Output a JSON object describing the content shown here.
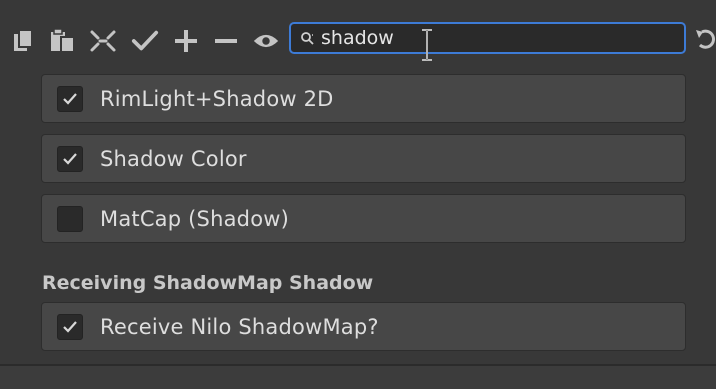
{
  "toolbar": {
    "icons": [
      "copy-icon",
      "paste-icon",
      "collapse-icon",
      "checkmark-icon",
      "plus-icon",
      "minus-icon",
      "eye-icon"
    ],
    "search": {
      "value": "shadow",
      "icon": "search-icon"
    },
    "undo_icon": "undo-icon",
    "accent": "#3d7bd6"
  },
  "rows": [
    {
      "label": "RimLight+Shadow 2D",
      "checked": true
    },
    {
      "label": "Shadow Color",
      "checked": true
    },
    {
      "label": "MatCap (Shadow)",
      "checked": false
    }
  ],
  "section": {
    "title": "Receiving ShadowMap Shadow",
    "rows": [
      {
        "label": "Receive Nilo ShadowMap?",
        "checked": true
      }
    ]
  }
}
